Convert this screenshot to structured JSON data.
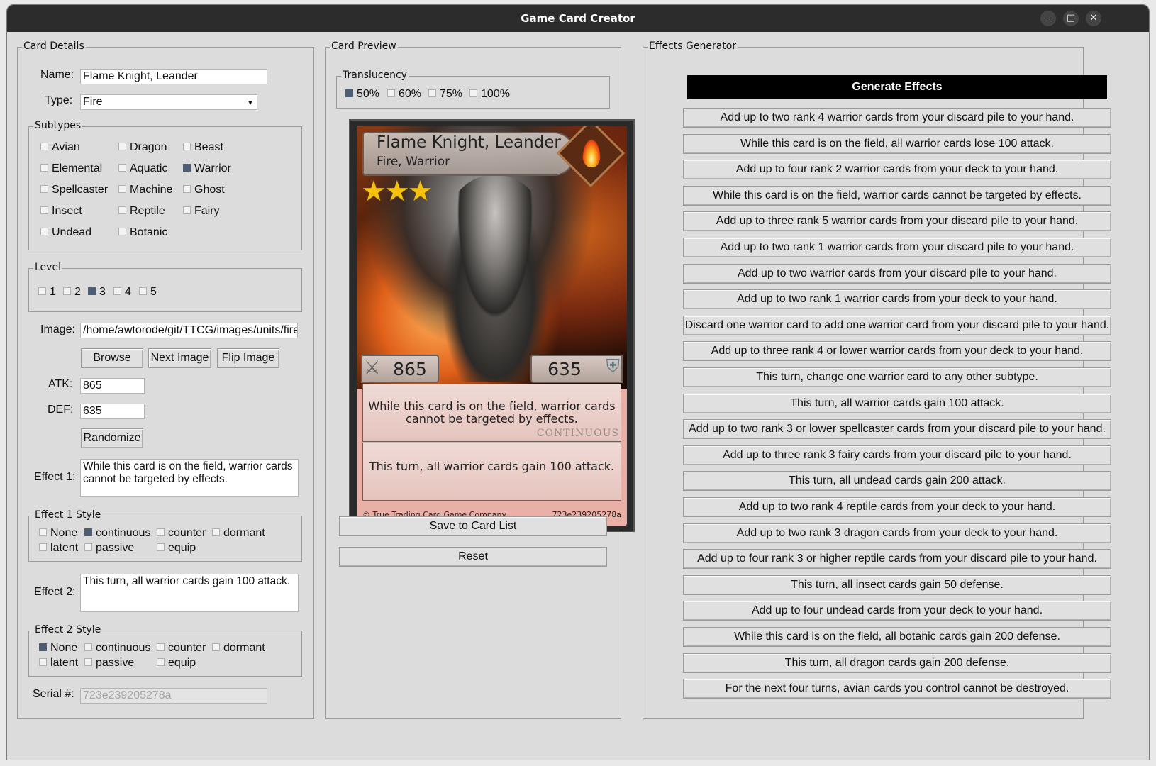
{
  "window": {
    "title": "Game Card Creator",
    "controls": {
      "minimize": "–",
      "maximize": "□",
      "close": "✕"
    }
  },
  "details": {
    "legend": "Card Details",
    "name_label": "Name:",
    "name_value": "Flame Knight, Leander",
    "type_label": "Type:",
    "type_value": "Fire",
    "subtypes_legend": "Subtypes",
    "subtypes": [
      {
        "label": "Avian",
        "checked": false
      },
      {
        "label": "Dragon",
        "checked": false
      },
      {
        "label": "Beast",
        "checked": false
      },
      {
        "label": "Elemental",
        "checked": false
      },
      {
        "label": "Aquatic",
        "checked": false
      },
      {
        "label": "Warrior",
        "checked": true
      },
      {
        "label": "Spellcaster",
        "checked": false
      },
      {
        "label": "Machine",
        "checked": false
      },
      {
        "label": "Ghost",
        "checked": false
      },
      {
        "label": "Insect",
        "checked": false
      },
      {
        "label": "Reptile",
        "checked": false
      },
      {
        "label": "Fairy",
        "checked": false
      },
      {
        "label": "Undead",
        "checked": false
      },
      {
        "label": "Botanic",
        "checked": false
      }
    ],
    "level_legend": "Level",
    "levels": [
      {
        "label": "1",
        "checked": false
      },
      {
        "label": "2",
        "checked": false
      },
      {
        "label": "3",
        "checked": true
      },
      {
        "label": "4",
        "checked": false
      },
      {
        "label": "5",
        "checked": false
      }
    ],
    "image_label": "Image:",
    "image_value": "/home/awtorode/git/TTCG/images/units/fire/_",
    "browse_label": "Browse",
    "next_image_label": "Next Image",
    "flip_image_label": "Flip Image",
    "atk_label": "ATK:",
    "atk_value": "865",
    "def_label": "DEF:",
    "def_value": "635",
    "randomize_label": "Randomize",
    "effect1_label": "Effect 1:",
    "effect1_value": "While this card is on the field, warrior cards cannot be targeted by effects.",
    "effect1_style_legend": "Effect 1 Style",
    "effect2_label": "Effect 2:",
    "effect2_value": "This turn, all warrior cards gain 100 attack.",
    "effect2_style_legend": "Effect 2 Style",
    "styles": [
      "None",
      "continuous",
      "counter",
      "dormant",
      "latent",
      "passive",
      "equip"
    ],
    "effect1_style": "continuous",
    "effect2_style": "None",
    "serial_label": "Serial #:",
    "serial_value": "723e239205278a"
  },
  "preview": {
    "legend": "Card Preview",
    "translucency_legend": "Translucency",
    "translucency_options": [
      {
        "label": "50%",
        "checked": true
      },
      {
        "label": "60%",
        "checked": false
      },
      {
        "label": "75%",
        "checked": false
      },
      {
        "label": "100%",
        "checked": false
      }
    ],
    "card": {
      "name": "Flame Knight, Leander",
      "type_line": "Fire, Warrior",
      "stars": "★★★",
      "atk": "865",
      "def": "635",
      "effect1": "While this card is on the field, warrior cards cannot be targeted by effects.",
      "effect1_tag": "CONTINUOUS",
      "effect2": "This turn, all warrior cards gain 100 attack.",
      "copyright": "© True Trading Card Game Company",
      "serial": "723e239205278a"
    },
    "save_label": "Save to Card List",
    "reset_label": "Reset"
  },
  "effects": {
    "legend": "Effects Generator",
    "generate_label": "Generate Effects",
    "items": [
      "Add up to two rank 4 warrior cards from your discard pile to your hand.",
      "While this card is on the field, all warrior cards lose 100 attack.",
      "Add up to four rank 2 warrior cards from your deck to your hand.",
      "While this card is on the field, warrior cards cannot be targeted by effects.",
      "Add up to three rank 5 warrior cards from your discard pile to your hand.",
      "Add up to two rank 1 warrior cards from your discard pile to your hand.",
      "Add up to two warrior cards from your discard pile to your hand.",
      "Add up to two rank 1 warrior cards from your deck to your hand.",
      "Discard one warrior card to add one warrior card from your discard pile to your hand.",
      "Add up to three rank 4 or lower warrior cards from your deck to your hand.",
      "This turn, change one warrior card to any other subtype.",
      "This turn, all warrior cards gain 100 attack.",
      "Add up to two rank 3 or lower spellcaster cards from your discard pile to your hand.",
      "Add up to three rank 3 fairy cards from your discard pile to your hand.",
      "This turn, all undead cards gain 200 attack.",
      "Add up to two rank 4 reptile cards from your deck to your hand.",
      "Add up to two rank 3 dragon cards from your deck to your hand.",
      "Add up to four rank 3 or higher reptile cards from your discard pile to your hand.",
      "This turn, all insect cards gain 50 defense.",
      "Add up to four undead cards from your deck to your hand.",
      "While this card is on the field, all botanic cards gain 200 defense.",
      "This turn, all dragon cards gain 200 defense.",
      "For the next four turns, avian cards you control cannot be destroyed."
    ]
  }
}
